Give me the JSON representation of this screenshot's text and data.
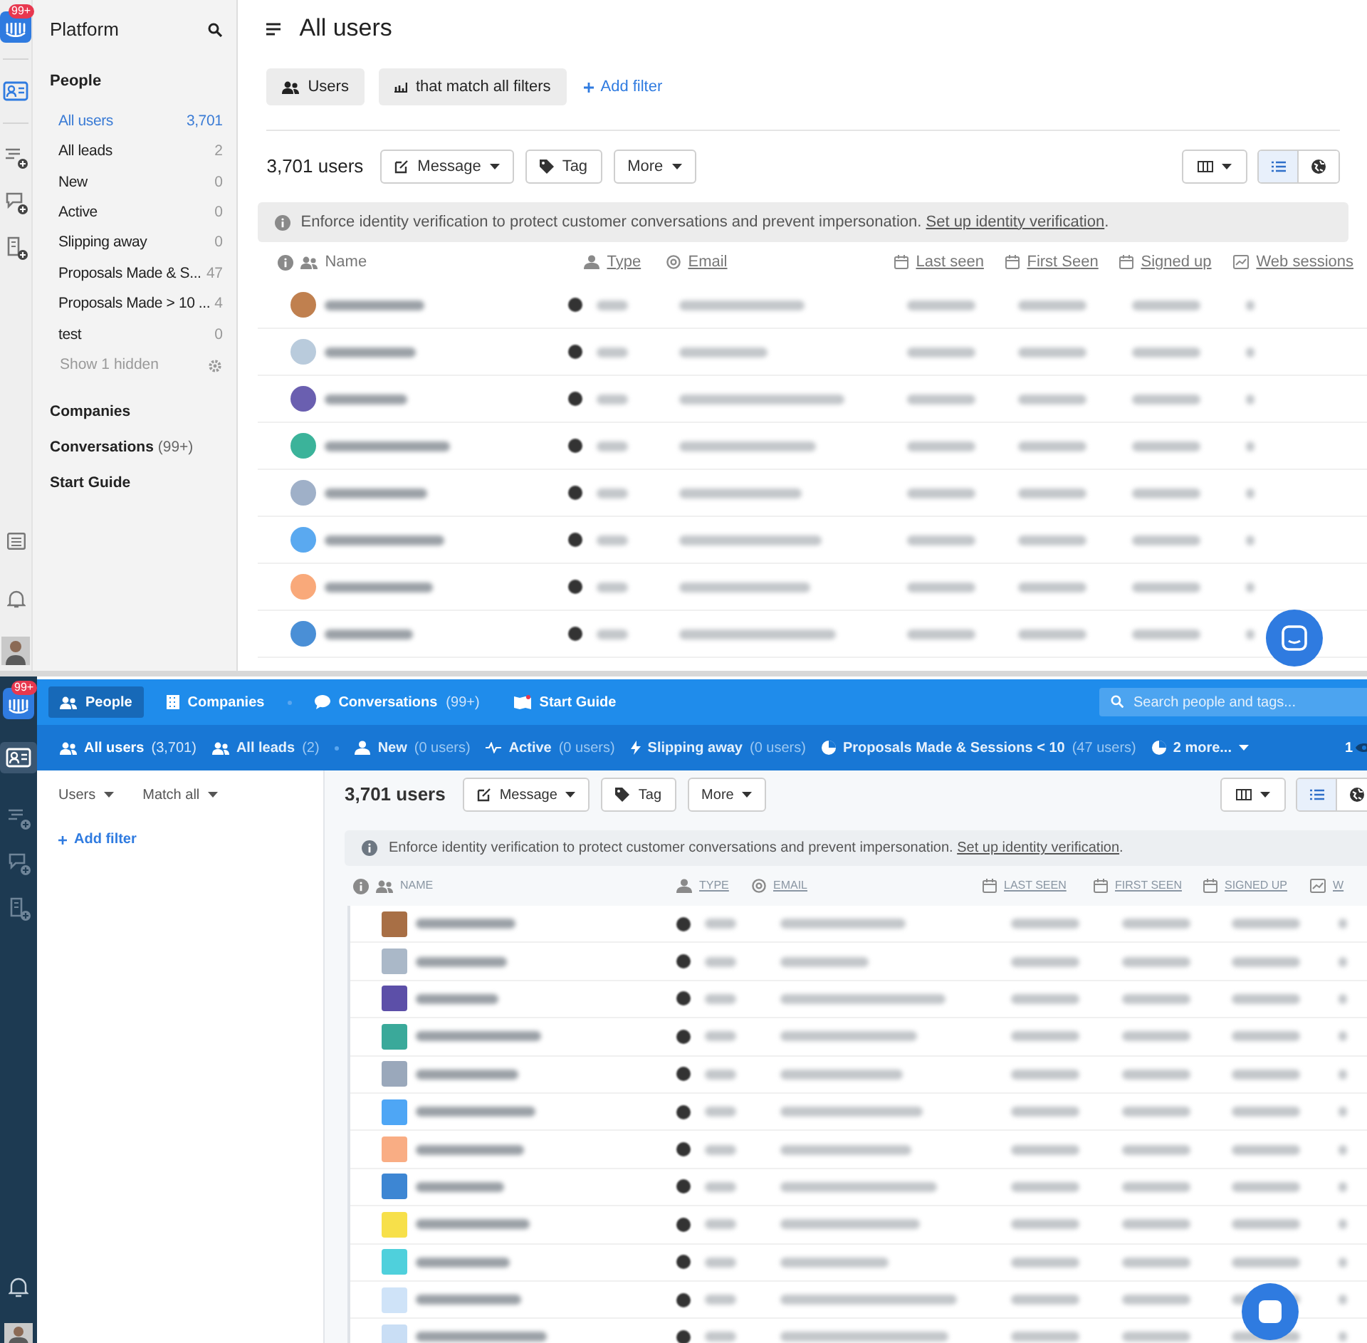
{
  "top": {
    "app_badge": "99+",
    "sidebar": {
      "title": "Platform",
      "section": "People",
      "items": [
        {
          "label": "All users",
          "count": "3,701",
          "selected": true
        },
        {
          "label": "All leads",
          "count": "2",
          "selected": false
        },
        {
          "label": "New",
          "count": "0",
          "selected": false
        },
        {
          "label": "Active",
          "count": "0",
          "selected": false
        },
        {
          "label": "Slipping away",
          "count": "0",
          "selected": false
        },
        {
          "label": "Proposals Made & S...",
          "count": "47",
          "selected": false
        },
        {
          "label": "Proposals Made > 10 ...",
          "count": "4",
          "selected": false
        },
        {
          "label": "test",
          "count": "0",
          "selected": false
        }
      ],
      "show_hidden": "Show 1 hidden",
      "links": [
        {
          "label": "Companies"
        },
        {
          "label": "Conversations",
          "count": "(99+)"
        },
        {
          "label": "Start Guide"
        }
      ]
    },
    "title": "All users",
    "filters": [
      "Users",
      "that match all filters"
    ],
    "add_filter": "Add filter",
    "count_label": "3,701 users",
    "actions": [
      "Message",
      "Tag",
      "More"
    ],
    "banner": {
      "text": "Enforce identity verification to protect customer conversations and prevent impersonation.",
      "link": "Set up identity verification",
      "suffix": "."
    },
    "columns": [
      "Name",
      "Type",
      "Email",
      "Last seen",
      "First Seen",
      "Signed up",
      "Web sessions"
    ],
    "rows": [
      {
        "color": "#c0804f"
      },
      {
        "color": "#b9cbdc"
      },
      {
        "color": "#6a5fb0"
      },
      {
        "color": "#3bb39a"
      },
      {
        "color": "#9fb0c8"
      },
      {
        "color": "#5aa9f0"
      },
      {
        "color": "#f9a97a"
      },
      {
        "color": "#4a8fd6"
      }
    ]
  },
  "bottom": {
    "app_badge": "99+",
    "nav": [
      {
        "label": "People",
        "selected": true
      },
      {
        "label": "Companies",
        "selected": false
      },
      {
        "label": "Conversations",
        "count": "(99+)",
        "selected": false
      },
      {
        "label": "Start Guide",
        "selected": false
      }
    ],
    "search": {
      "placeholder": "Search people and tags..."
    },
    "segments": [
      {
        "label": "All users",
        "count": "(3,701)",
        "selected": true
      },
      {
        "label": "All leads",
        "count": "(2)",
        "selected": false
      },
      {
        "label": "New",
        "count": "(0 users)",
        "selected": false
      },
      {
        "label": "Active",
        "count": "(0 users)",
        "selected": false
      },
      {
        "label": "Slipping away",
        "count": "(0 users)",
        "selected": false
      },
      {
        "label": "Proposals Made & Sessions < 10",
        "count": "(47 users)",
        "selected": false
      },
      {
        "label": "2 more...",
        "selected": false
      }
    ],
    "hidden_count": "1",
    "filters": [
      "Users",
      "Match all"
    ],
    "add_filter": "Add filter",
    "count_label": "3,701 users",
    "actions": [
      "Message",
      "Tag",
      "More"
    ],
    "banner": {
      "text": "Enforce identity verification to protect customer conversations and prevent impersonation.",
      "link": "Set up identity verification",
      "suffix": "."
    },
    "columns": [
      "NAME",
      "TYPE",
      "EMAIL",
      "LAST SEEN",
      "FIRST SEEN",
      "SIGNED UP",
      "W"
    ],
    "rows": [
      {
        "color": "#a86f45"
      },
      {
        "color": "#aab8c8"
      },
      {
        "color": "#5c4fa8"
      },
      {
        "color": "#3aa99a"
      },
      {
        "color": "#9aa8bb"
      },
      {
        "color": "#4ea6f5"
      },
      {
        "color": "#f9ad84"
      },
      {
        "color": "#3d86d3"
      },
      {
        "color": "#f7e04a"
      },
      {
        "color": "#4fd0dc"
      },
      {
        "color": "#cfe3f8"
      },
      {
        "color": "#c9def5"
      }
    ]
  }
}
